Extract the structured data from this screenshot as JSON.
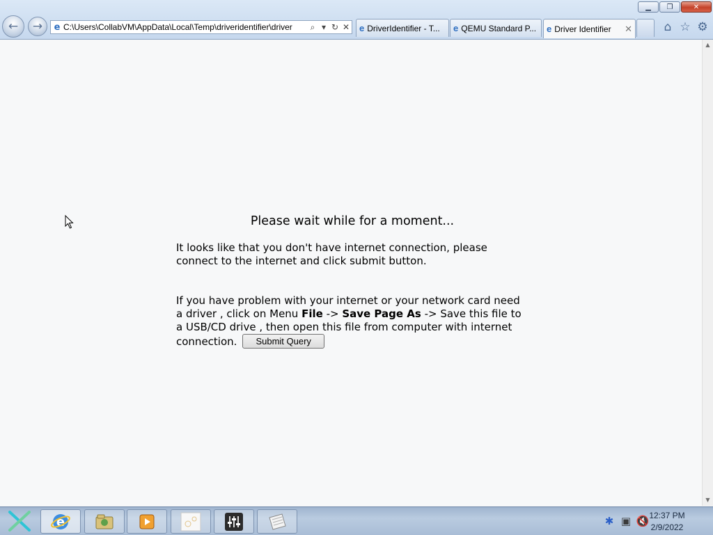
{
  "window": {
    "minimize_icon": "minimize-icon",
    "restore_icon": "restore-icon",
    "close_icon": "close-icon"
  },
  "toolbar": {
    "address": "C:\\Users\\CollabVM\\AppData\\Local\\Temp\\driveridentifier\\driver"
  },
  "tabs": [
    {
      "label": "DriverIdentifier - T...",
      "active": false
    },
    {
      "label": "QEMU Standard P...",
      "active": false
    },
    {
      "label": "Driver Identifier",
      "active": true
    }
  ],
  "content": {
    "heading": "Please wait while for a moment...",
    "p1": "It looks like that you don't have internet connection, please connect to the internet and click submit button.",
    "p2_a": "If you have problem with your internet or your network card need a driver , click on Menu ",
    "p2_file": "File",
    "p2_arrow1": " -> ",
    "p2_save": "Save Page As",
    "p2_b": " -> Save this file to a USB/CD drive , then open this file from computer with internet connection.",
    "submit_label": "Submit Query"
  },
  "taskbar": {
    "time": "12:37 PM",
    "date": "2/9/2022"
  },
  "colors": {
    "chrome": "#c6d8ee",
    "page_background": "#f7f8f9",
    "close_button": "#c4412a",
    "taskbar": "#b9cbe0"
  }
}
